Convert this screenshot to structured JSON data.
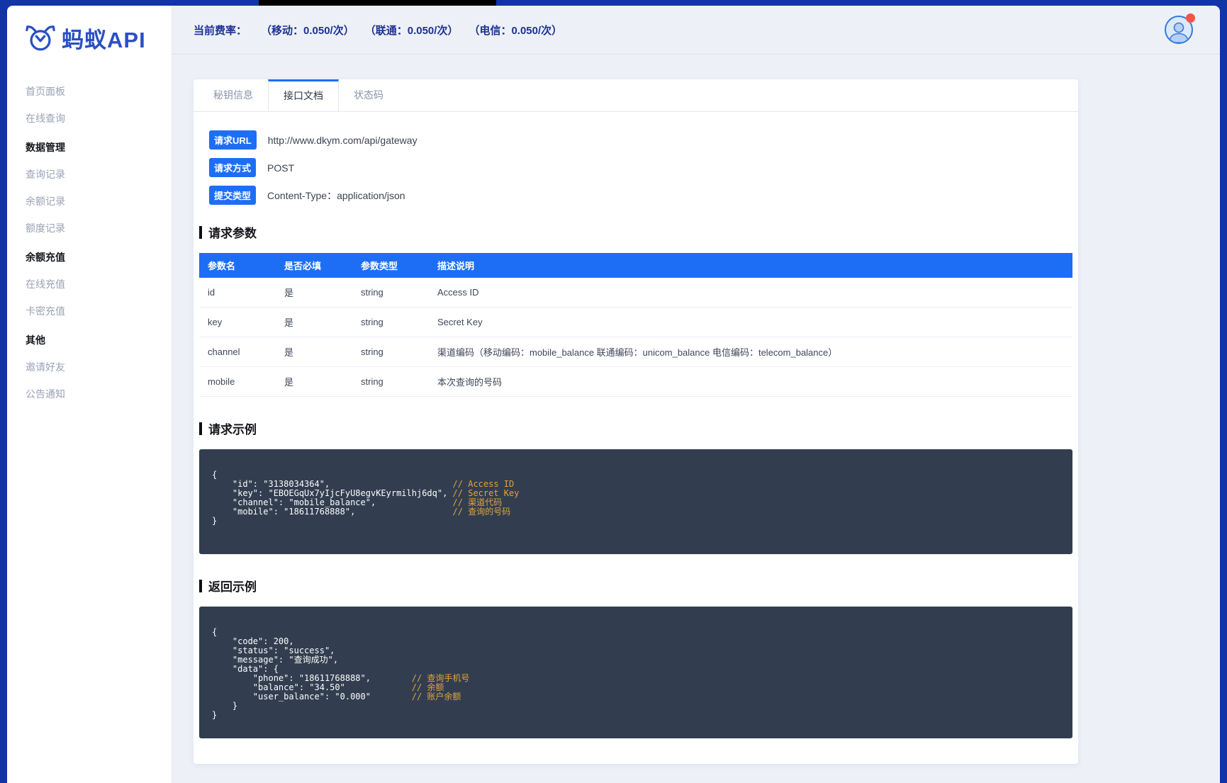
{
  "app": {
    "logo_text": "蚂蚁API"
  },
  "colors": {
    "accent_blue": "#1e6ef5",
    "frame_blue": "#1134a6",
    "code_bg": "#323e50",
    "comment_orange": "#e2a33d",
    "notification_dot": "#f25642"
  },
  "topbar": {
    "fee_label": "当前费率：",
    "fees": [
      "（移动：0.050/次）",
      "（联通：0.050/次）",
      "（电信：0.050/次）"
    ]
  },
  "sidebar": {
    "items": [
      {
        "label": "首页面板",
        "type": "link"
      },
      {
        "label": "在线查询",
        "type": "link"
      },
      {
        "label": "数据管理",
        "type": "section"
      },
      {
        "label": "查询记录",
        "type": "link"
      },
      {
        "label": "余额记录",
        "type": "link"
      },
      {
        "label": "额度记录",
        "type": "link"
      },
      {
        "label": "余额充值",
        "type": "section"
      },
      {
        "label": "在线充值",
        "type": "link"
      },
      {
        "label": "卡密充值",
        "type": "link"
      },
      {
        "label": "其他",
        "type": "section"
      },
      {
        "label": "邀请好友",
        "type": "link"
      },
      {
        "label": "公告通知",
        "type": "link"
      }
    ]
  },
  "tabs": [
    {
      "label": "秘钥信息",
      "active": false
    },
    {
      "label": "接口文档",
      "active": true
    },
    {
      "label": "状态码",
      "active": false
    }
  ],
  "request_info": [
    {
      "badge": "请求URL",
      "value": "http://www.dkym.com/api/gateway"
    },
    {
      "badge": "请求方式",
      "value": "POST"
    },
    {
      "badge": "提交类型",
      "value": "Content-Type：application/json"
    }
  ],
  "params_table": {
    "title": "请求参数",
    "columns": [
      "参数名",
      "是否必填",
      "参数类型",
      "描述说明"
    ],
    "rows": [
      [
        "id",
        "是",
        "string",
        "Access ID"
      ],
      [
        "key",
        "是",
        "string",
        "Secret Key"
      ],
      [
        "channel",
        "是",
        "string",
        "渠道编码（移动编码：mobile_balance 联通编码：unicom_balance 电信编码：telecom_balance）"
      ],
      [
        "mobile",
        "是",
        "string",
        "本次查询的号码"
      ]
    ]
  },
  "request_example": {
    "title": "请求示例",
    "lines": [
      {
        "code": "{",
        "comment": ""
      },
      {
        "code": "    \"id\": \"3138034364\",",
        "comment": "// Access ID"
      },
      {
        "code": "    \"key\": \"EBOEGqUx7yIjcFyU8egvKEyrmilhj6dq\",",
        "comment": "// Secret Key"
      },
      {
        "code": "    \"channel\": \"mobile_balance\",",
        "comment": "// 渠道代码"
      },
      {
        "code": "    \"mobile\": \"18611768888\",",
        "comment": "// 查询的号码"
      },
      {
        "code": "}",
        "comment": ""
      }
    ]
  },
  "response_example": {
    "title": "返回示例",
    "lines": [
      {
        "code": "{",
        "comment": ""
      },
      {
        "code": "    \"code\": 200,",
        "comment": ""
      },
      {
        "code": "    \"status\": \"success\",",
        "comment": ""
      },
      {
        "code": "    \"message\": \"查询成功\",",
        "comment": ""
      },
      {
        "code": "    \"data\": {",
        "comment": ""
      },
      {
        "code": "        \"phone\": \"18611768888\",",
        "comment": "// 查询手机号"
      },
      {
        "code": "        \"balance\": \"34.50\"",
        "comment": "// 余额"
      },
      {
        "code": "        \"user_balance\": \"0.000\"",
        "comment": "// 账户余额"
      },
      {
        "code": "    }",
        "comment": ""
      },
      {
        "code": "}",
        "comment": ""
      }
    ]
  }
}
